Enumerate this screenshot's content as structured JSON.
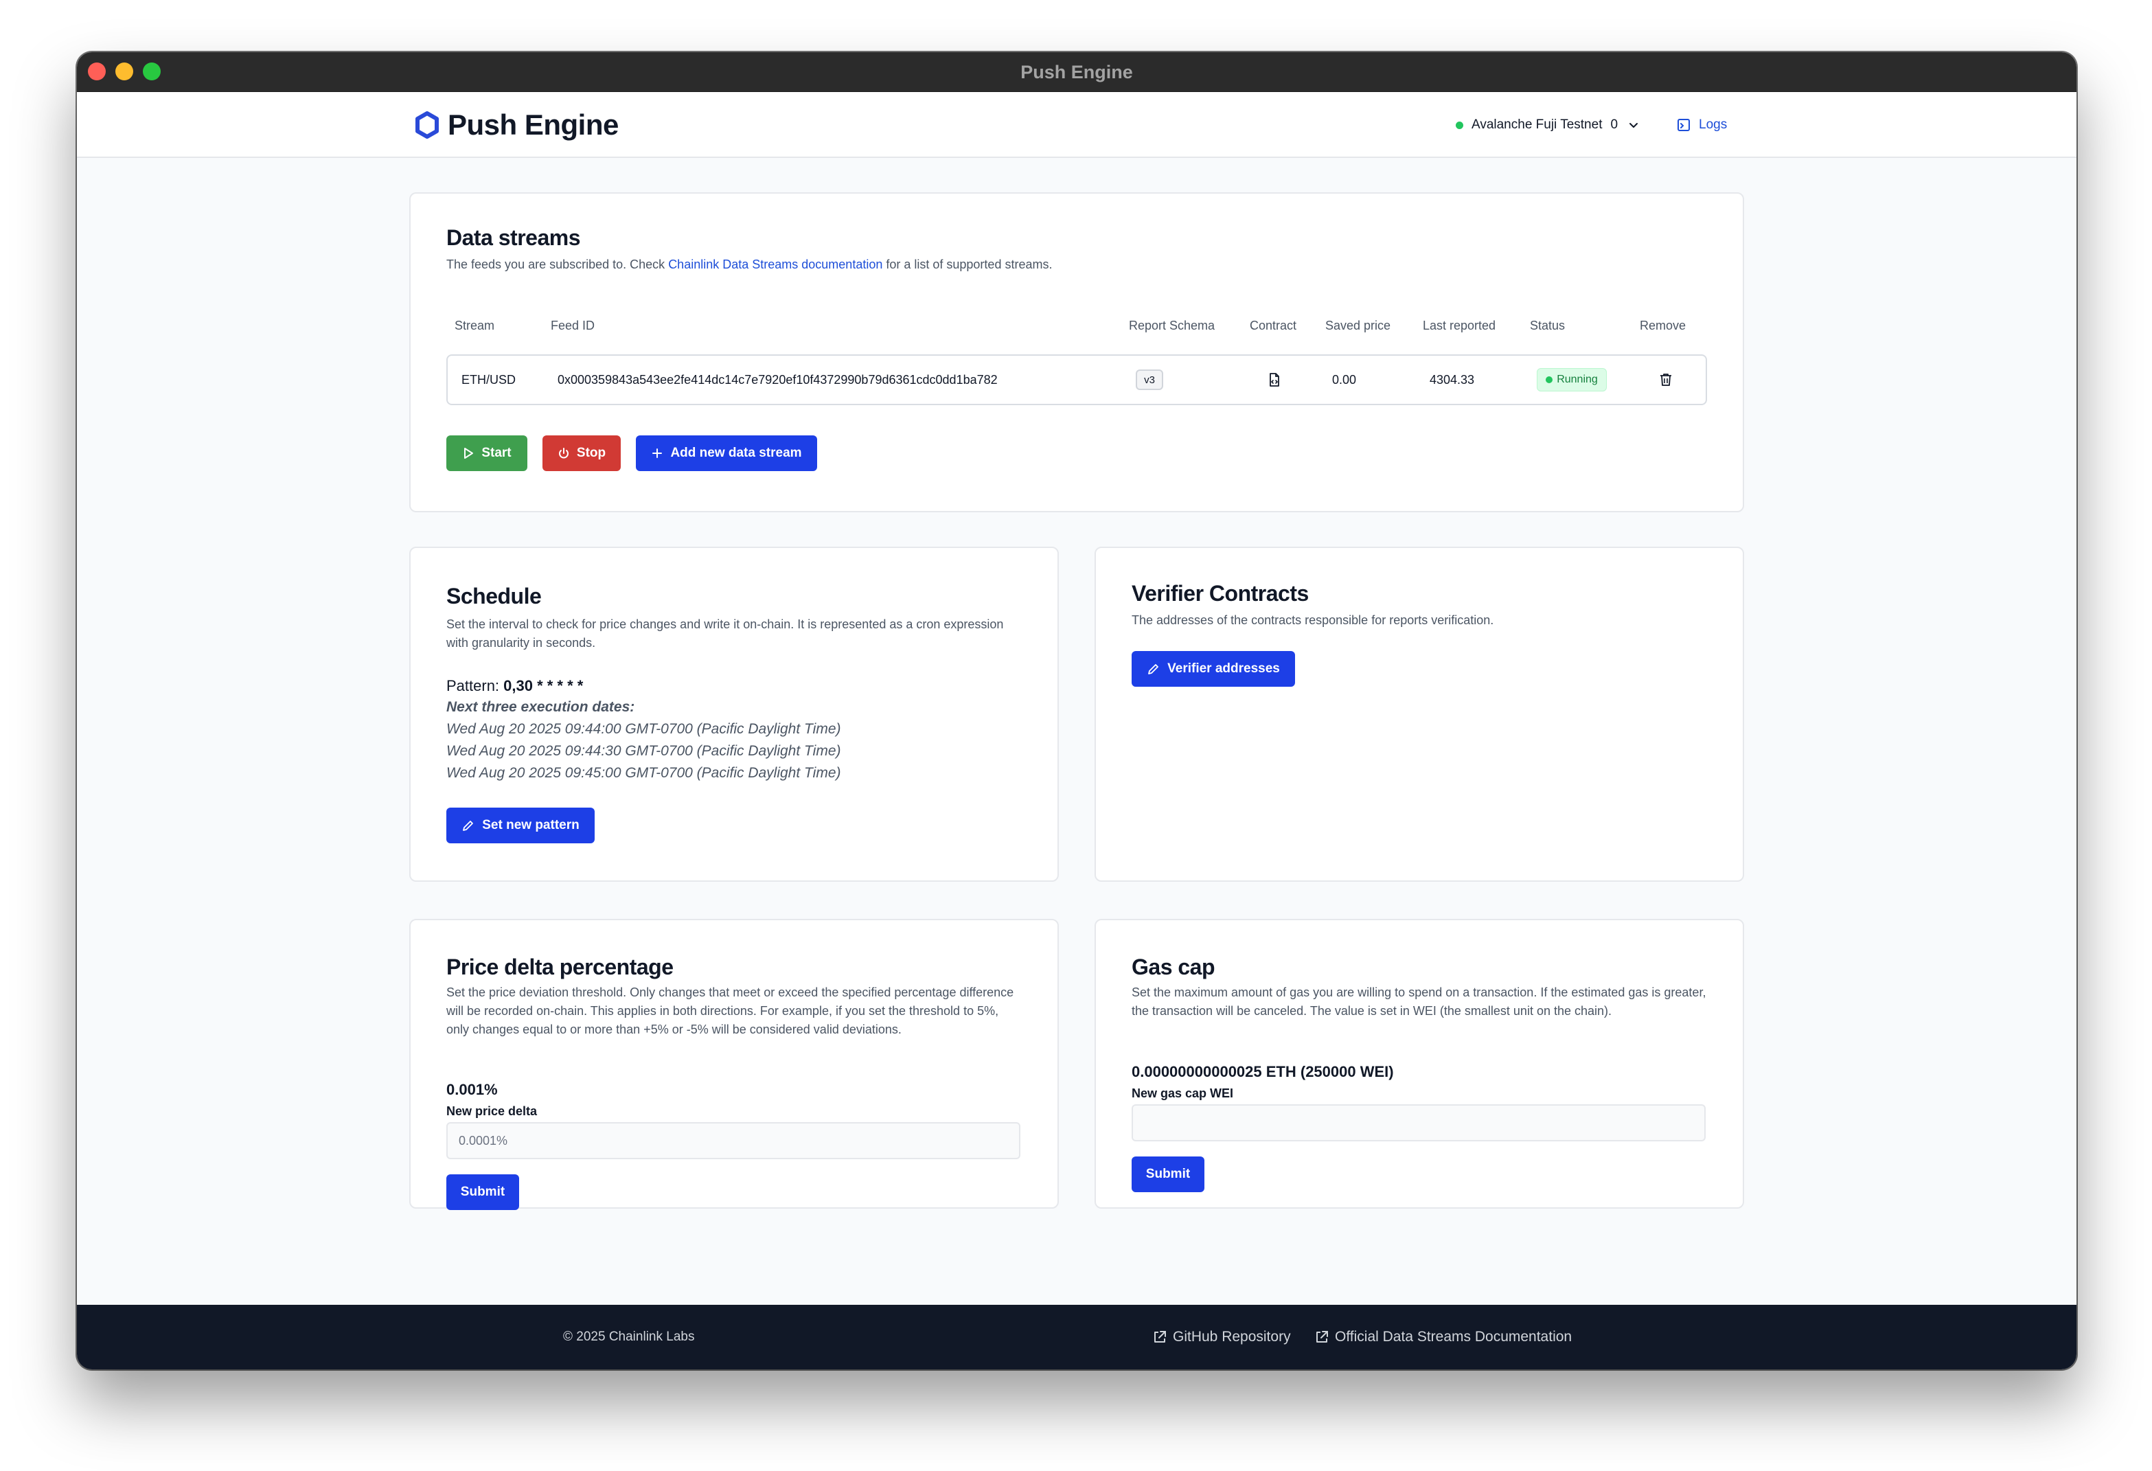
{
  "window": {
    "title": "Push Engine"
  },
  "header": {
    "brand": "Push Engine",
    "network": "Avalanche Fuji Testnet",
    "network_count": "0",
    "logs_label": "Logs"
  },
  "data_streams": {
    "title": "Data streams",
    "desc_prefix": "The feeds you are subscribed to. Check ",
    "desc_link": "Chainlink Data Streams documentation",
    "desc_suffix": " for a list of supported streams.",
    "columns": [
      "Stream",
      "Feed ID",
      "Report Schema",
      "Contract",
      "Saved price",
      "Last reported",
      "Status",
      "Remove"
    ],
    "rows": [
      {
        "stream": "ETH/USD",
        "feed_id": "0x000359843a543ee2fe414dc14c7e7920ef10f4372990b79d6361cdc0dd1ba782",
        "schema": "v3",
        "saved_price": "0.00",
        "last_reported": "4304.33",
        "status": "Running"
      }
    ],
    "start_label": "Start",
    "stop_label": "Stop",
    "add_label": "Add new data stream"
  },
  "schedule": {
    "title": "Schedule",
    "description": "Set the interval to check for price changes and write it on-chain. It is represented as a cron expression with granularity in seconds.",
    "pattern_label": "Pattern: ",
    "pattern_value": "0,30 * * * * *",
    "next_label": "Next three execution dates:",
    "dates": [
      "Wed Aug 20 2025 09:44:00 GMT-0700 (Pacific Daylight Time)",
      "Wed Aug 20 2025 09:44:30 GMT-0700 (Pacific Daylight Time)",
      "Wed Aug 20 2025 09:45:00 GMT-0700 (Pacific Daylight Time)"
    ],
    "button_label": "Set new pattern"
  },
  "verifier": {
    "title": "Verifier Contracts",
    "description": "The addresses of the contracts responsible for reports verification.",
    "button_label": "Verifier addresses"
  },
  "price_delta": {
    "title": "Price delta percentage",
    "description": "Set the price deviation threshold. Only changes that meet or exceed the specified percentage difference will be recorded on-chain. This applies in both directions. For example, if you set the threshold to 5%, only changes equal to or more than +5% or -5% will be considered valid deviations.",
    "current_value": "0.001%",
    "input_label": "New price delta",
    "input_placeholder": "0.0001%",
    "submit_label": "Submit"
  },
  "gas_cap": {
    "title": "Gas cap",
    "description": "Set the maximum amount of gas you are willing to spend on a transaction. If the estimated gas is greater, the transaction will be canceled. The value is set in WEI (the smallest unit on the chain).",
    "current_value": "0.00000000000025 ETH (250000 WEI)",
    "input_label": "New gas cap WEI",
    "input_placeholder": "",
    "submit_label": "Submit"
  },
  "footer": {
    "copyright": "© 2025 Chainlink Labs",
    "github_label": "GitHub Repository",
    "docs_label": "Official Data Streams Documentation"
  }
}
